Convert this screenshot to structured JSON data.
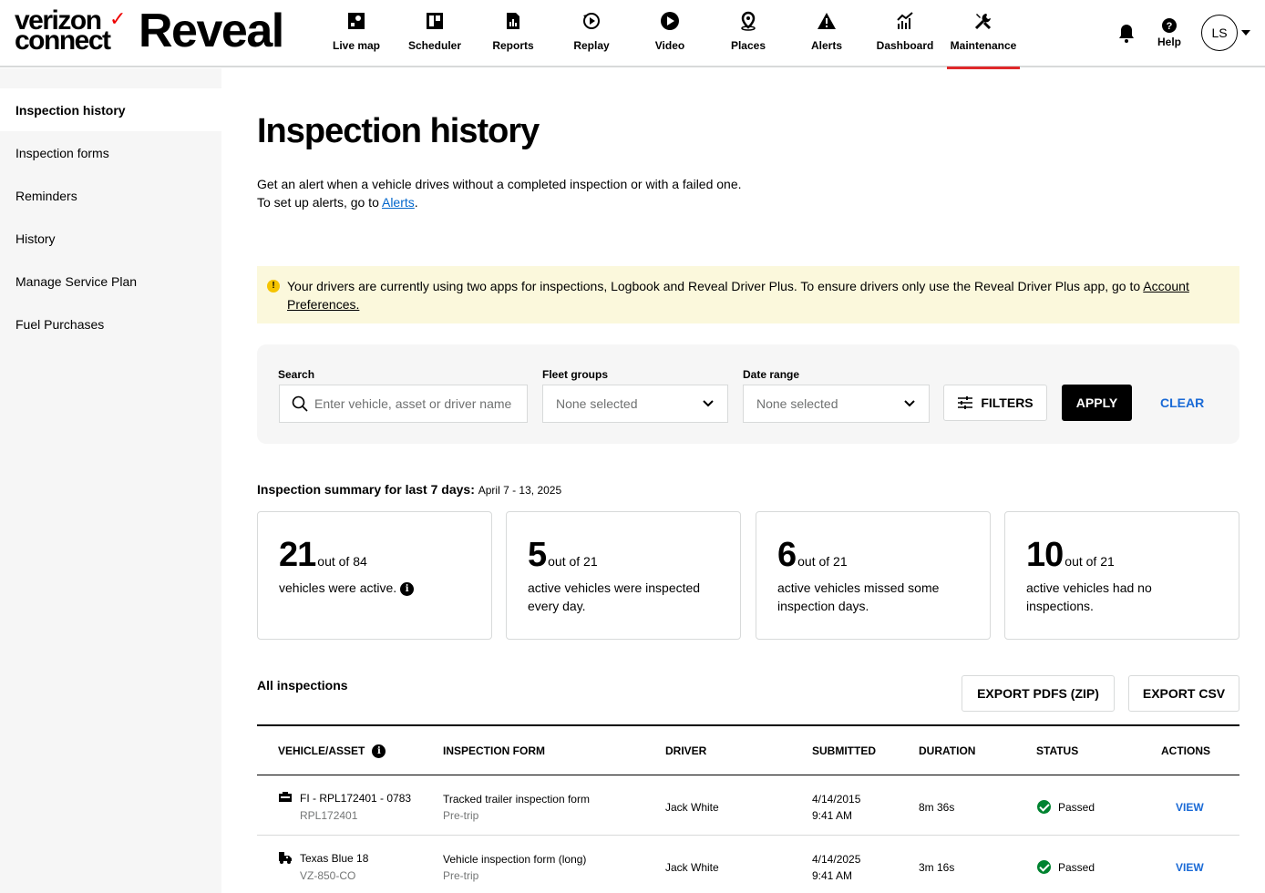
{
  "brand": {
    "company_line1": "verizon",
    "company_line2": "connect",
    "product": "Reveal"
  },
  "nav": [
    {
      "label": "Live map",
      "icon": "live-map-icon"
    },
    {
      "label": "Scheduler",
      "icon": "scheduler-icon"
    },
    {
      "label": "Reports",
      "icon": "reports-icon"
    },
    {
      "label": "Replay",
      "icon": "replay-icon"
    },
    {
      "label": "Video",
      "icon": "video-icon"
    },
    {
      "label": "Places",
      "icon": "places-icon"
    },
    {
      "label": "Alerts",
      "icon": "alerts-icon"
    },
    {
      "label": "Dashboard",
      "icon": "dashboard-icon"
    },
    {
      "label": "Maintenance",
      "icon": "maintenance-icon",
      "active": true
    }
  ],
  "header_right": {
    "help_label": "Help",
    "avatar_initials": "LS"
  },
  "sidebar": {
    "items": [
      {
        "label": "Inspection history",
        "active": true
      },
      {
        "label": "Inspection forms"
      },
      {
        "label": "Reminders"
      },
      {
        "label": "History"
      },
      {
        "label": "Manage Service Plan"
      },
      {
        "label": "Fuel Purchases"
      }
    ]
  },
  "page": {
    "title": "Inspection history",
    "intro_line1": "Get an alert when a vehicle drives without a completed inspection or with a failed one.",
    "intro_line2_prefix": "To set up alerts, go to ",
    "intro_link": "Alerts",
    "intro_line2_suffix": "."
  },
  "notice": {
    "icon": "warning-icon",
    "text": "Your drivers are currently using two apps for inspections, Logbook and Reveal Driver Plus. To ensure drivers only use the Reveal Driver Plus app, go to ",
    "link": "Account Preferences."
  },
  "filters": {
    "search_label": "Search",
    "search_placeholder": "Enter vehicle, asset or driver name",
    "fleet_label": "Fleet groups",
    "fleet_value": "None selected",
    "date_label": "Date range",
    "date_value": "None selected",
    "filters_button": "FILTERS",
    "apply_button": "APPLY",
    "clear_button": "CLEAR"
  },
  "summary": {
    "heading": "Inspection summary for last 7 days:",
    "range": "April 7 - 13, 2025",
    "cards": [
      {
        "num": "21",
        "of": "out of 84",
        "text": "vehicles were active."
      },
      {
        "num": "5",
        "of": "out of 21",
        "text": "active vehicles were inspected every day."
      },
      {
        "num": "6",
        "of": "out of 21",
        "text": "active vehicles missed some inspection days."
      },
      {
        "num": "10",
        "of": "out of 21",
        "text": "active vehicles had no inspections."
      }
    ]
  },
  "inspections": {
    "heading": "All inspections",
    "export_pdfs": "EXPORT PDFS (ZIP)",
    "export_csv": "EXPORT CSV",
    "columns": [
      "VEHICLE/ASSET",
      "INSPECTION FORM",
      "DRIVER",
      "SUBMITTED",
      "DURATION",
      "STATUS",
      "ACTIONS"
    ],
    "rows": [
      {
        "icon": "trailer-icon",
        "vehicle": "FI - RPL172401 - 0783",
        "vehicle_sub": "RPL172401",
        "form": "Tracked trailer inspection form",
        "form_sub": "Pre-trip",
        "driver": "Jack White",
        "date": "4/14/2015",
        "time": "9:41 AM",
        "duration": "8m 36s",
        "status": "Passed",
        "action": "VIEW"
      },
      {
        "icon": "truck-icon",
        "vehicle": "Texas Blue 18",
        "vehicle_sub": "VZ-850-CO",
        "form": "Vehicle inspection form (long)",
        "form_sub": "Pre-trip",
        "driver": "Jack White",
        "date": "4/14/2025",
        "time": "9:41 AM",
        "duration": "3m 16s",
        "status": "Passed",
        "action": "VIEW"
      }
    ]
  },
  "colors": {
    "accent_red": "#e0282a",
    "link_blue": "#1a6ad6",
    "notice_bg": "#fbf8dc",
    "status_green": "#008330"
  }
}
